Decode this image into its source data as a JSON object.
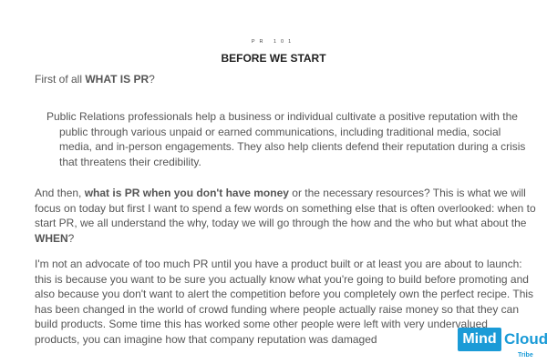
{
  "header": {
    "kicker": "PR 101",
    "title": "BEFORE WE START"
  },
  "intro": {
    "prefix": "First of all ",
    "bold": "WHAT IS PR",
    "suffix": "?"
  },
  "quote": {
    "lines": [
      "Public Relations professionals help a business or individual cultivate a positive reputation with the",
      "public through various unpaid or earned communications, including traditional media, social",
      "media, and in-person engagements. They also help clients defend their reputation during a crisis",
      "that threatens their credibility."
    ]
  },
  "paragraph2": {
    "line1_prefix": "And then, ",
    "line1_bold": "what is PR when you don't have money",
    "line1_suffix": " or the necessary resources? This is what we will",
    "line2": "focus on today but first I want to spend a few words on something else that is often overlooked: when to",
    "line3": "start PR, we all understand the why, today we will go through the how and the who but what about the",
    "line4_bold": "WHEN",
    "line4_suffix": "?"
  },
  "paragraph3": {
    "lines": [
      "I'm not an advocate of too much PR until you have a product built or at least you are about to launch:",
      "this is because you want to be sure you actually know what you're going to build before promoting and",
      "also because you don't want to alert the competition before you completely own the perfect recipe. This",
      "has been changed in the world of crowd funding where people actually raise money so that they can",
      "build products. Some time this has worked some other people were left with very undervalued",
      "products, you can imagine how that company reputation was damaged"
    ]
  },
  "logo": {
    "mind": "Mind",
    "cloud": "Cloud",
    "tribe": "Tribe",
    "brand_color": "#1a9bd7"
  }
}
